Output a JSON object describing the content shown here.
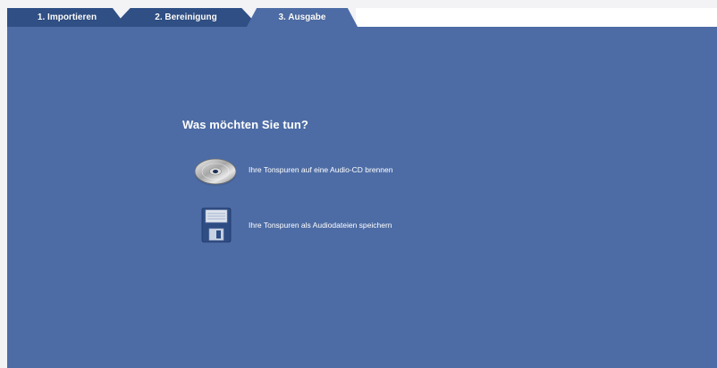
{
  "tabs": [
    {
      "label": "1. Importieren",
      "state": "inactive"
    },
    {
      "label": "2. Bereinigung",
      "state": "inactive"
    },
    {
      "label": "3. Ausgabe",
      "state": "active"
    }
  ],
  "main": {
    "heading": "Was möchten Sie tun?",
    "options": [
      {
        "label": "Ihre Tonspuren auf eine Audio-CD brennen",
        "icon": "cd-disc-icon"
      },
      {
        "label": "Ihre Tonspuren als Audiodateien speichern",
        "icon": "floppy-disk-icon"
      }
    ]
  },
  "colors": {
    "panel": "#4d6ca5",
    "tab_inactive": "#2f4f85",
    "tab_active": "#4d6ca5",
    "page_background": "#f3f2f5"
  }
}
